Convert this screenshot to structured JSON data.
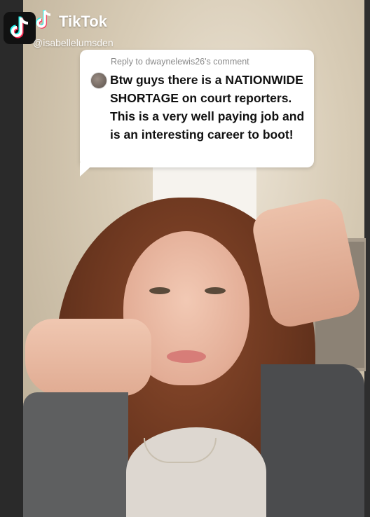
{
  "app": {
    "name": "TikTok",
    "handle": "@isabellelumsden"
  },
  "comment_reply": {
    "reply_label": "Reply to dwaynelewis26's comment",
    "text": "Btw guys there is a NATIONWIDE SHORTAGE on court reporters. This is a very well paying job and is an interesting career to boot!"
  },
  "colors": {
    "tiktok_cyan": "#25F4EE",
    "tiktok_red": "#FE2C55"
  },
  "icons": {
    "logo": "tiktok-logo-icon",
    "note": "music-note-icon"
  }
}
